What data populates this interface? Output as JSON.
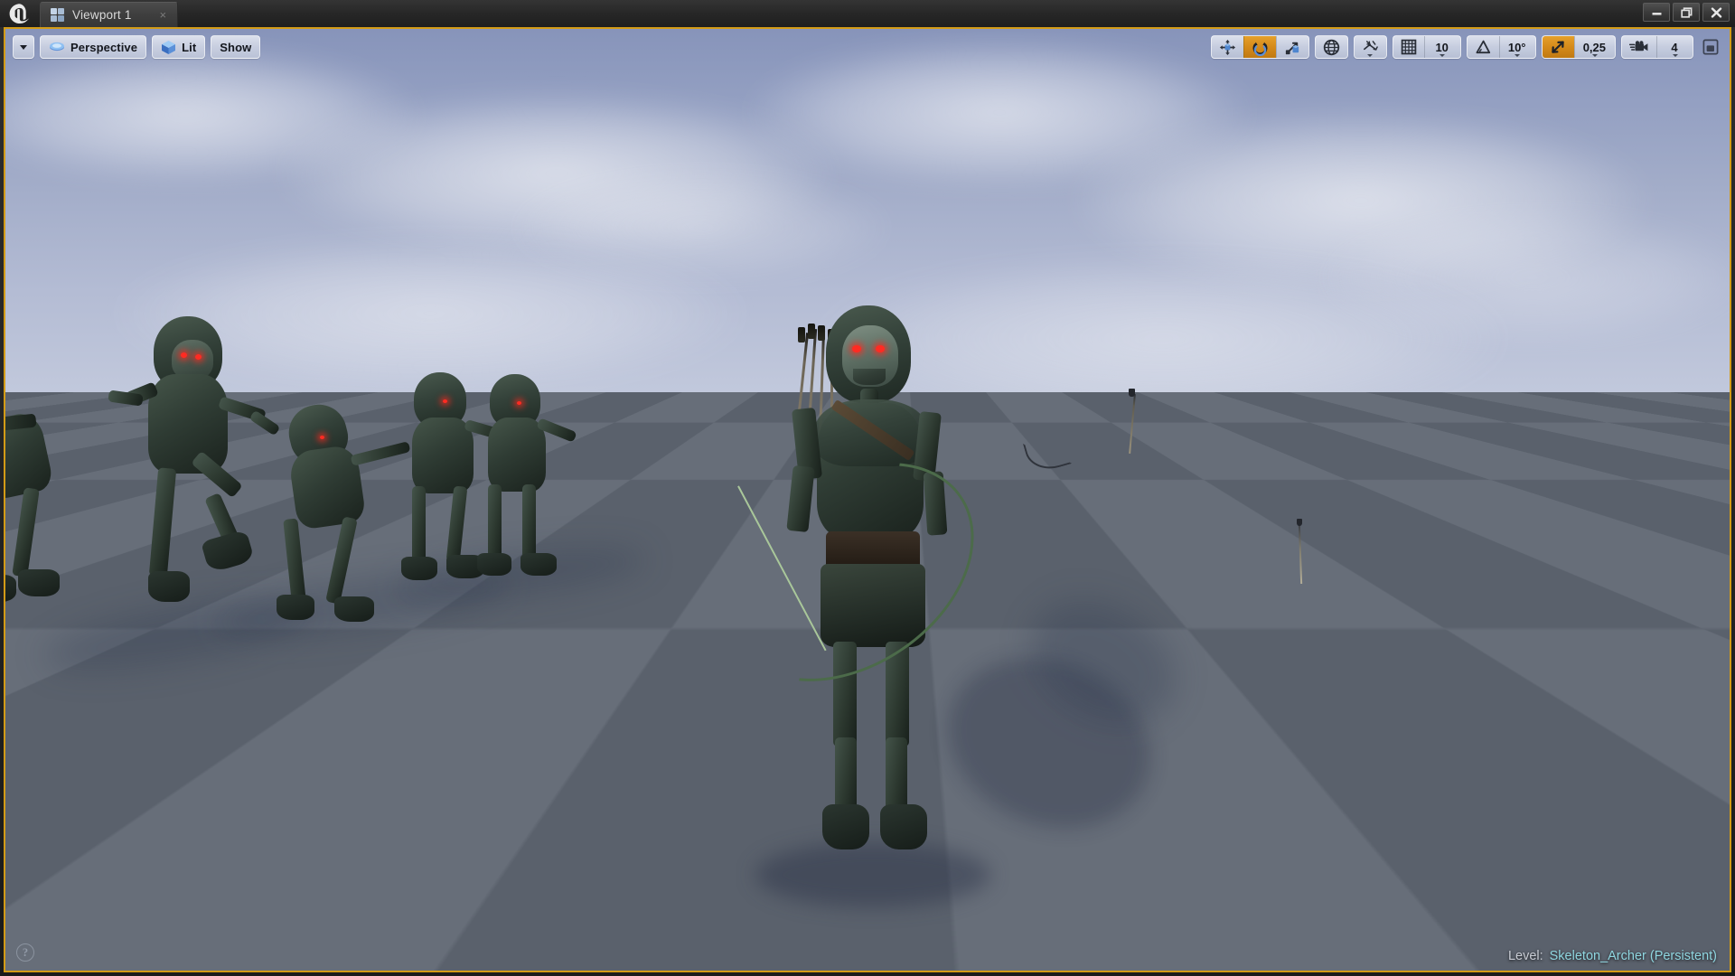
{
  "window": {
    "logo_icon": "unreal-engine-logo",
    "buttons": [
      {
        "name": "minimize",
        "icon": "minimize-icon"
      },
      {
        "name": "restore",
        "icon": "restore-icon"
      },
      {
        "name": "close",
        "icon": "close-icon"
      }
    ]
  },
  "tab": {
    "label": "Viewport 1",
    "icon": "viewport-grid-icon",
    "close_label": "×"
  },
  "viewport_toolbar_left": {
    "options_caret": "▾",
    "view_mode": {
      "label": "Perspective",
      "icon": "camera-icon"
    },
    "lighting_mode": {
      "label": "Lit",
      "icon": "cube-icon"
    },
    "show": {
      "label": "Show"
    }
  },
  "viewport_toolbar_right": {
    "transform_tools": [
      {
        "name": "translate",
        "icon": "move-arrows-icon",
        "active": false
      },
      {
        "name": "rotate",
        "icon": "rotate-icon",
        "active": true
      },
      {
        "name": "scale",
        "icon": "scale-icon",
        "active": false
      }
    ],
    "coordinate_system": {
      "name": "world-space",
      "icon": "globe-icon"
    },
    "surface_snap": {
      "name": "surface-snapping",
      "icon": "surface-snap-icon"
    },
    "grid_snap": {
      "name": "grid-snap",
      "icon": "grid-icon",
      "value": "10",
      "enabled": false
    },
    "rotation_snap": {
      "name": "rotation-snap",
      "icon": "angle-icon",
      "value": "10°",
      "enabled": false
    },
    "scale_snap": {
      "name": "scale-snap",
      "icon": "scale-snap-arrow-icon",
      "value": "0,25",
      "enabled": true
    },
    "camera_speed": {
      "name": "camera-speed",
      "icon": "camera-speed-icon",
      "value": "4"
    },
    "maximize": {
      "name": "maximize-viewport",
      "icon": "maximize-icon"
    }
  },
  "overlays": {
    "help": {
      "icon": "help-icon",
      "glyph": "?"
    },
    "level_status": {
      "label": "Level:",
      "value": "Skeleton_Archer (Persistent)"
    }
  },
  "scene": {
    "description": "Unreal Engine level viewport showing skeleton archer characters on a checkerboard ground plane under a cloudy sky",
    "level_name": "Skeleton_Archer",
    "hero_character": "skeleton-archer-with-bow",
    "background_characters": 5,
    "props": [
      "floating-bow",
      "floating-arrow",
      "ground-arrow"
    ],
    "colors": {
      "viewport_border": "#d39b16",
      "sky_top": "#8794ba",
      "sky_horizon": "#e5e7ee",
      "floor_dark": "#5a616c",
      "floor_light": "#676e79",
      "accent_orange": "#d4891a",
      "status_value": "#8fd6e0",
      "eye_glow": "#ff2b22"
    }
  }
}
